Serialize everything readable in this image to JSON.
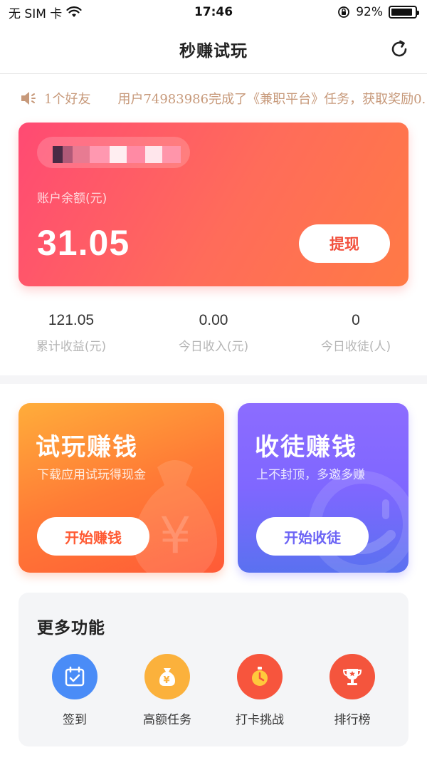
{
  "status_bar": {
    "carrier": "无 SIM 卡",
    "time": "17:46",
    "battery_text": "92%",
    "battery_level": 0.92
  },
  "nav": {
    "title": "秒赚试玩"
  },
  "marquee": {
    "friend_count": "1个好友",
    "message": "用户74983986完成了《兼职平台》任务，获取奖励0."
  },
  "account": {
    "balance_label": "账户余额(元)",
    "balance_value": "31.05",
    "withdraw_label": "提现"
  },
  "stats": [
    {
      "value": "121.05",
      "label": "累计收益(元)"
    },
    {
      "value": "0.00",
      "label": "今日收入(元)"
    },
    {
      "value": "0",
      "label": "今日收徒(人)"
    }
  ],
  "promos": {
    "trial": {
      "title": "试玩赚钱",
      "subtitle": "下载应用试玩得现金",
      "button": "开始赚钱"
    },
    "recruit": {
      "title": "收徒赚钱",
      "subtitle": "上不封顶，多邀多赚",
      "button": "开始收徒"
    }
  },
  "more": {
    "title": "更多功能",
    "features": [
      {
        "label": "签到",
        "icon": "calendar-check-icon",
        "color": "#4a8cf7"
      },
      {
        "label": "高额任务",
        "icon": "money-bag-icon",
        "color": "#fbb13c"
      },
      {
        "label": "打卡挑战",
        "icon": "stopwatch-icon",
        "color": "#f7553d"
      },
      {
        "label": "排行榜",
        "icon": "trophy-icon",
        "color": "#f4553d"
      }
    ]
  },
  "colors": {
    "balance_gradient_start": "#ff4a73",
    "balance_gradient_end": "#ff7a45",
    "trial_gradient_start": "#ffad3a",
    "recruit_gradient_start": "#8c6cff",
    "accent_text": "#c7997a"
  }
}
